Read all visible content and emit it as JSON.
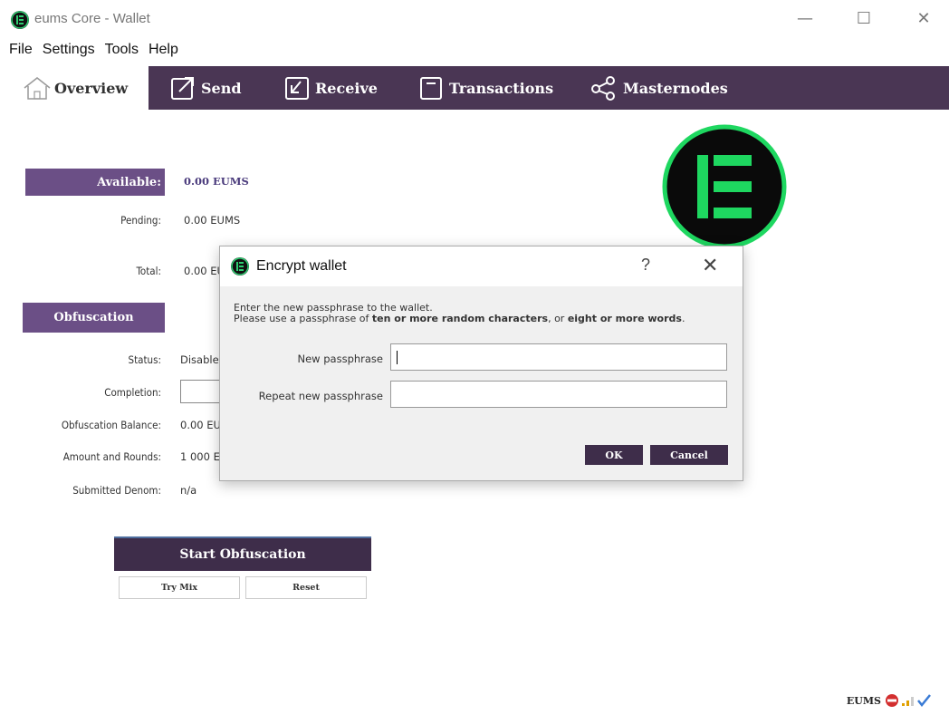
{
  "window": {
    "title": "eums Core - Wallet",
    "minimize_glyph": "—",
    "maximize_glyph": "☐",
    "close_glyph": "✕"
  },
  "menu": [
    "File",
    "Settings",
    "Tools",
    "Help"
  ],
  "toolbar": {
    "overview": "Overview",
    "send": "Send",
    "receive": "Receive",
    "transactions": "Transactions",
    "masternodes": "Masternodes"
  },
  "balances": {
    "header": "Available:",
    "available": "0.00 EUMS",
    "pending_label": "Pending:",
    "pending": "0.00 EUMS",
    "total_label": "Total:",
    "total": "0.00 EU"
  },
  "obfuscation": {
    "header": "Obfuscation",
    "status_label": "Status:",
    "status": "Disabled",
    "completion_label": "Completion:",
    "balance_label": "Obfuscation Balance:",
    "balance": "0.00 EU",
    "amount_label": "Amount and Rounds:",
    "amount": "1 000 E",
    "denom_label": "Submitted Denom:",
    "denom": "n/a",
    "start_button": "Start Obfuscation",
    "try_mix": "Try Mix",
    "reset": "Reset"
  },
  "status_bar": {
    "unit": "EUMS"
  },
  "dialog": {
    "title": "Encrypt wallet",
    "help": "?",
    "close": "✕",
    "line1": "Enter the new passphrase to the wallet.",
    "line2_a": "Please use a passphrase of ",
    "line2_b": "ten or more random characters",
    "line2_c": ", or ",
    "line2_d": "eight or more words",
    "line2_e": ".",
    "new_label": "New passphrase",
    "new_value": "",
    "repeat_label": "Repeat new passphrase",
    "repeat_value": "",
    "ok": "OK",
    "cancel": "Cancel"
  },
  "colors": {
    "toolbar_bg": "#4a3654",
    "header_purple": "#6b4f86",
    "button_dark": "#3e2d4a",
    "logo_green": "#00c853"
  },
  "icons": [
    "house-icon",
    "send-icon",
    "receive-icon",
    "transactions-icon",
    "share-nodes-icon",
    "eums-logo",
    "no-entry-icon",
    "signal-bars-icon",
    "checkmark-icon"
  ]
}
